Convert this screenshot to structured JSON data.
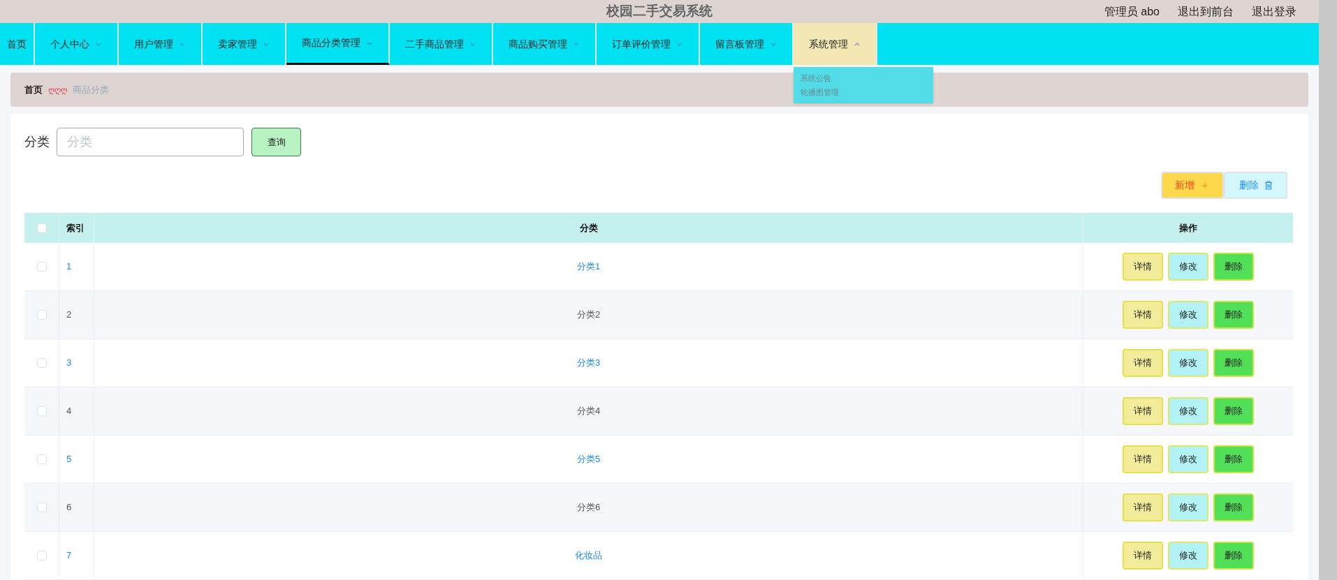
{
  "header": {
    "title": "校园二手交易系统",
    "user": "管理员 abo",
    "links": [
      "退出到前台",
      "退出登录"
    ]
  },
  "nav": [
    {
      "label": "首页",
      "selected": false,
      "has_menu": false,
      "expanded": false
    },
    {
      "label": "个人中心",
      "selected": false,
      "has_menu": true,
      "expanded": false
    },
    {
      "label": "用户管理",
      "selected": false,
      "has_menu": true,
      "expanded": false
    },
    {
      "label": "卖家管理",
      "selected": false,
      "has_menu": true,
      "expanded": false
    },
    {
      "label": "商品分类管理",
      "selected": true,
      "has_menu": true,
      "expanded": false
    },
    {
      "label": "二手商品管理",
      "selected": false,
      "has_menu": true,
      "expanded": false
    },
    {
      "label": "商品购买管理",
      "selected": false,
      "has_menu": true,
      "expanded": false
    },
    {
      "label": "订单评价管理",
      "selected": false,
      "has_menu": true,
      "expanded": false
    },
    {
      "label": "留言板管理",
      "selected": false,
      "has_menu": true,
      "expanded": false
    },
    {
      "label": "系统管理",
      "selected": false,
      "has_menu": true,
      "expanded": true,
      "menu": [
        "系统公告",
        "轮播图管理"
      ]
    }
  ],
  "breadcrumb": {
    "home": "首页",
    "separator": "ღღღ",
    "current": "商品分类"
  },
  "search": {
    "label": "分类",
    "placeholder": "分类",
    "button": "查询"
  },
  "actions": {
    "add": "新增",
    "add_icon": "＋",
    "delete": "删除"
  },
  "table": {
    "columns": [
      "索引",
      "分类",
      "操作"
    ],
    "all_checked": false,
    "rows": [
      {
        "index": "1",
        "category": "分类1",
        "kind": "link",
        "checked": false,
        "actions": [
          "详情",
          "修改",
          "删除"
        ]
      },
      {
        "index": "2",
        "category": "分类2",
        "kind": "text",
        "checked": false,
        "actions": [
          "详情",
          "修改",
          "删除"
        ]
      },
      {
        "index": "3",
        "category": "分类3",
        "kind": "link",
        "checked": false,
        "actions": [
          "详情",
          "修改",
          "删除"
        ]
      },
      {
        "index": "4",
        "category": "分类4",
        "kind": "text",
        "checked": false,
        "actions": [
          "详情",
          "修改",
          "删除"
        ]
      },
      {
        "index": "5",
        "category": "分类5",
        "kind": "link",
        "checked": false,
        "actions": [
          "详情",
          "修改",
          "删除"
        ]
      },
      {
        "index": "6",
        "category": "分类6",
        "kind": "text",
        "checked": false,
        "actions": [
          "详情",
          "修改",
          "删除"
        ]
      },
      {
        "index": "7",
        "category": "化妆品",
        "kind": "link",
        "checked": false,
        "actions": [
          "详情",
          "修改",
          "删除"
        ]
      }
    ]
  }
}
